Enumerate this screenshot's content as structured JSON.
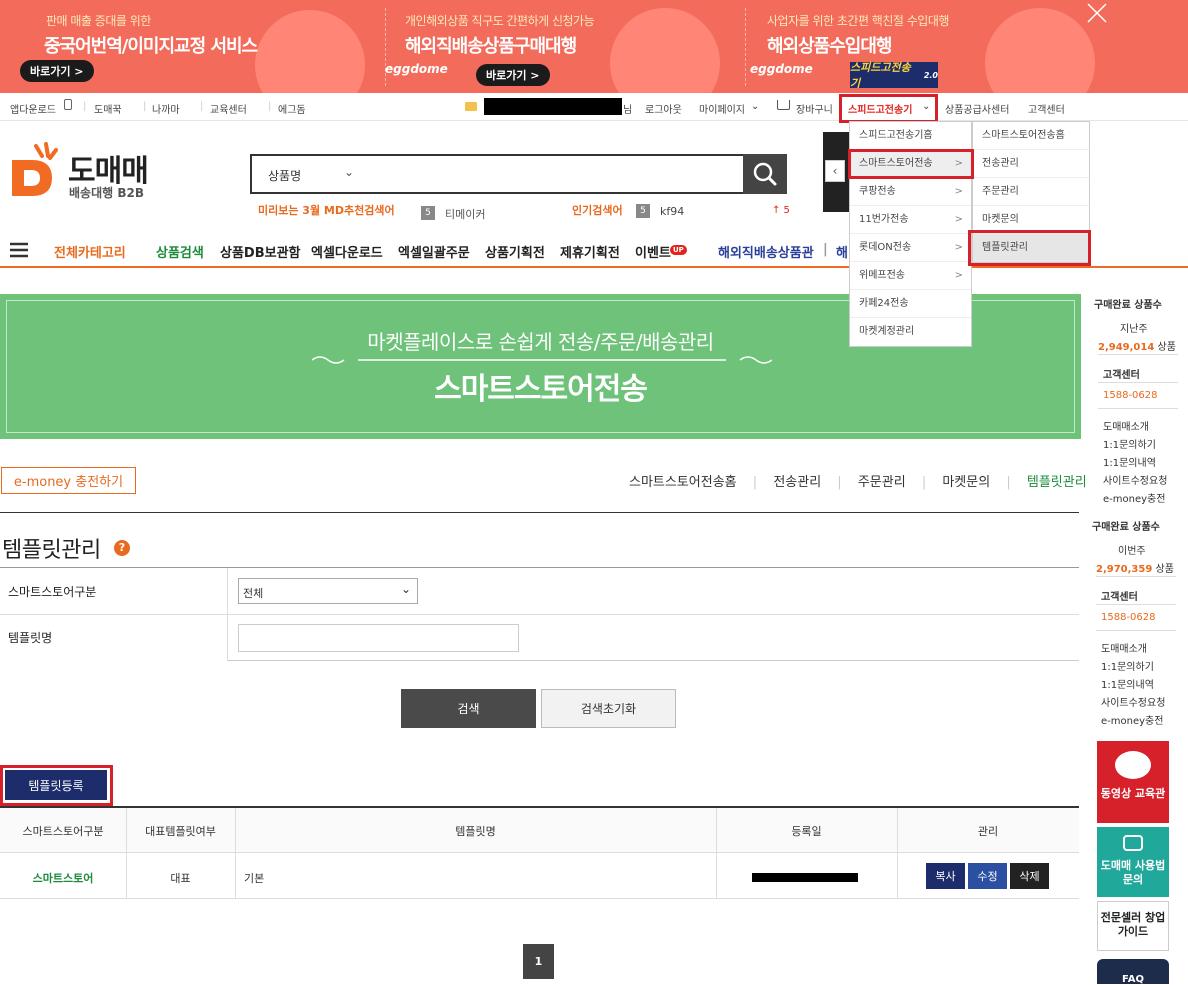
{
  "banner": {
    "items": [
      {
        "sub": "판매 매출 증대를 위한",
        "main": "중국어번역/이미지교정 서비스",
        "button": "바로가기 >"
      },
      {
        "sub": "개인해외상품 직구도 간편하게 신청가능",
        "main": "해외직배송상품구매대행",
        "button": "바로가기 >",
        "brand": "eggdome"
      },
      {
        "sub": "사업자를 위한 초간편 핵친절 수입대행",
        "main": "해외상품수입대행",
        "brand": "eggdome"
      }
    ],
    "badge": "스피드고전송기",
    "badge_ver": "2.0"
  },
  "util": {
    "app_download": "앱다운로드",
    "links": [
      "도매꾹",
      "나까마",
      "교육센터",
      "에그돔"
    ],
    "user_suffix": "님",
    "logout": "로그아웃",
    "mypage": "마이페이지",
    "cart": "장바구니",
    "speedgo": "스피드고전송기",
    "supplier": "상품공급사센터",
    "support": "고객센터"
  },
  "header": {
    "logo_text": "도매매",
    "logo_sub": "배송대행 B2B",
    "search_select": "상품명",
    "md_label": "미리보는 3월 MD추천검색어",
    "md_rank": "5",
    "md_term": "티메이커",
    "popular_label": "인기검색어",
    "popular_rank": "5",
    "popular_term": "kf94",
    "popular_change": "↑ 5"
  },
  "catnav": {
    "all": "전체카테고리",
    "items": [
      "상품검색",
      "상품DB보관함",
      "엑셀다운로드",
      "엑셀일괄주문",
      "상품기획전",
      "제휴기획전",
      "이벤트"
    ],
    "event_badge": "UP",
    "overseas": "해외직배송상품관",
    "overseas_trunc": "해"
  },
  "menu1": [
    "스피드고전송기홈",
    "스마트스토어전송",
    "쿠팡전송",
    "11번가전송",
    "롯데ON전송",
    "위메프전송",
    "카페24전송",
    "마켓계정관리"
  ],
  "menu2": [
    "스마트스토어전송홈",
    "전송관리",
    "주문관리",
    "마켓문의",
    "템플릿관리"
  ],
  "gbanner": {
    "sub": "마켓플레이스로 손쉽게 전송/주문/배송관리",
    "title": "스마트스토어전송"
  },
  "subnav": {
    "emoney": "e-money 충전하기",
    "links": [
      "스마트스토어전송홈",
      "전송관리",
      "주문관리",
      "마켓문의",
      "템플릿관리"
    ]
  },
  "page": {
    "title": "템플릿관리",
    "help": "?"
  },
  "form": {
    "store_label": "스마트스토어구분",
    "store_value": "전체",
    "name_label": "템플릿명",
    "name_value": "",
    "search_btn": "검색",
    "reset_btn": "검색초기화"
  },
  "register_btn": "템플릿등록",
  "table": {
    "headers": [
      "스마트스토어구분",
      "대표템플릿여부",
      "템플릿명",
      "등록일",
      "관리"
    ],
    "rows": [
      {
        "store": "스마트스토어",
        "rep": "대표",
        "name": "기본",
        "date": ""
      }
    ],
    "actions": [
      "복사",
      "수정",
      "삭제"
    ]
  },
  "pagination": {
    "current": "1"
  },
  "sidebar": {
    "block1": {
      "title": "구매완료 상품수",
      "period": "지난주",
      "count": "2,949,014",
      "unit": "상품",
      "cs_title": "고객센터",
      "phone": "1588-0628",
      "links": [
        "도매매소개",
        "1:1문의하기",
        "1:1문의내역",
        "사이트수정요청",
        "e-money충전"
      ]
    },
    "block2": {
      "title": "구매완료 상품수",
      "period": "이번주",
      "count": "2,970,359",
      "unit": "상품",
      "cs_title": "고객센터",
      "phone": "1588-0628",
      "links": [
        "도매매소개",
        "1:1문의하기",
        "1:1문의내역",
        "사이트수정요청",
        "e-money충전"
      ]
    },
    "promo1": "동영상 교육관",
    "promo2": "도매매 사용법문의",
    "promo3": "전문셀러 창업가이드",
    "promo4": "FAQ"
  }
}
